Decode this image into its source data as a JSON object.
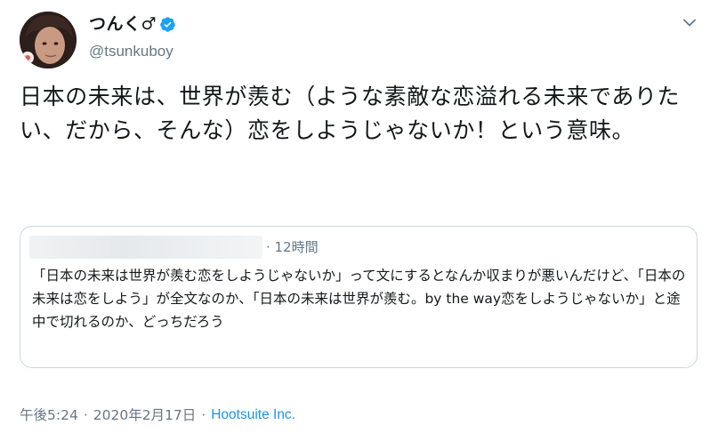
{
  "author": {
    "display_name": "つんく♂",
    "username": "@tsunkuboy",
    "verified": true,
    "avatar_icon": "user-avatar"
  },
  "tweet": {
    "text": "日本の未来は、世界が羨む（ような素敵な恋溢れる未来でありたい、だから、そんな）恋をしようじゃないか！という意味。"
  },
  "quoted_tweet": {
    "time": "· 12時間",
    "text": "「日本の未来は世界が羨む恋をしようじゃないか」って文にするとなんか収まりが悪いんだけど、「日本の未来は恋をしよう」が全文なのか、「日本の未来は世界が羨む。by the way恋をしようじゃないか」と途中で切れるのか、どっちだろう"
  },
  "meta": {
    "time": "午後5:24",
    "date": "2020年2月17日",
    "separator": "·",
    "source": "Hootsuite Inc."
  },
  "colors": {
    "text": "#14171a",
    "secondary": "#657786",
    "link": "#1b95e0",
    "verified": "#1da1f2",
    "border": "#ccd6dd"
  },
  "icons": {
    "menu": "chevron-down-icon",
    "verified": "verified-badge-icon"
  }
}
